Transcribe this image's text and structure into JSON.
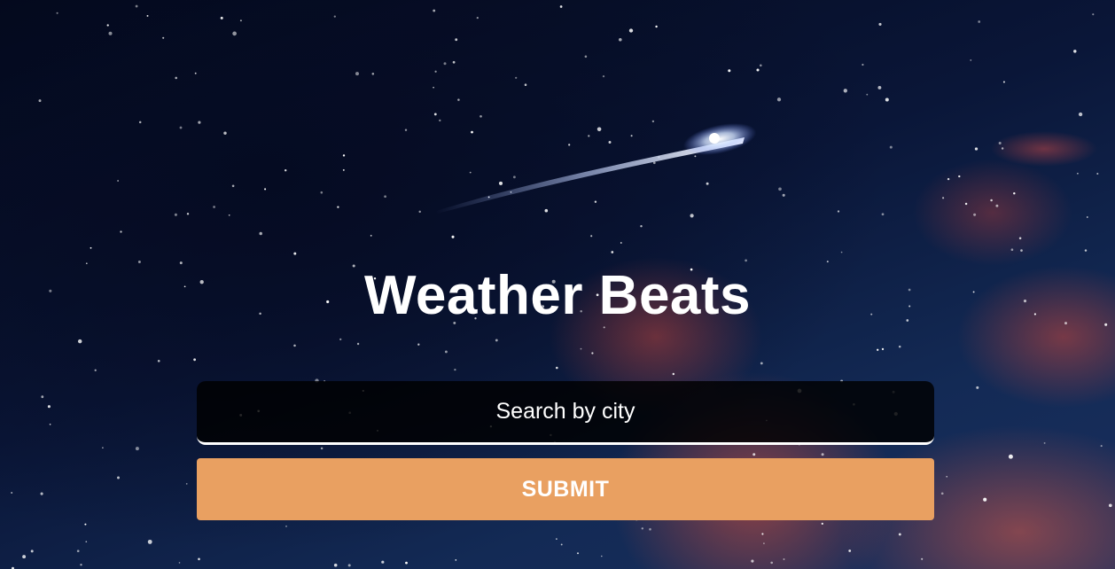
{
  "app": {
    "title": "Weather Beats"
  },
  "search": {
    "placeholder": "Search by city",
    "value": ""
  },
  "actions": {
    "submit_label": "SUBMIT"
  },
  "colors": {
    "submit_button": "#e9a061",
    "title_text": "#ffffff",
    "search_background": "#000000",
    "sky": "#0a1638"
  }
}
